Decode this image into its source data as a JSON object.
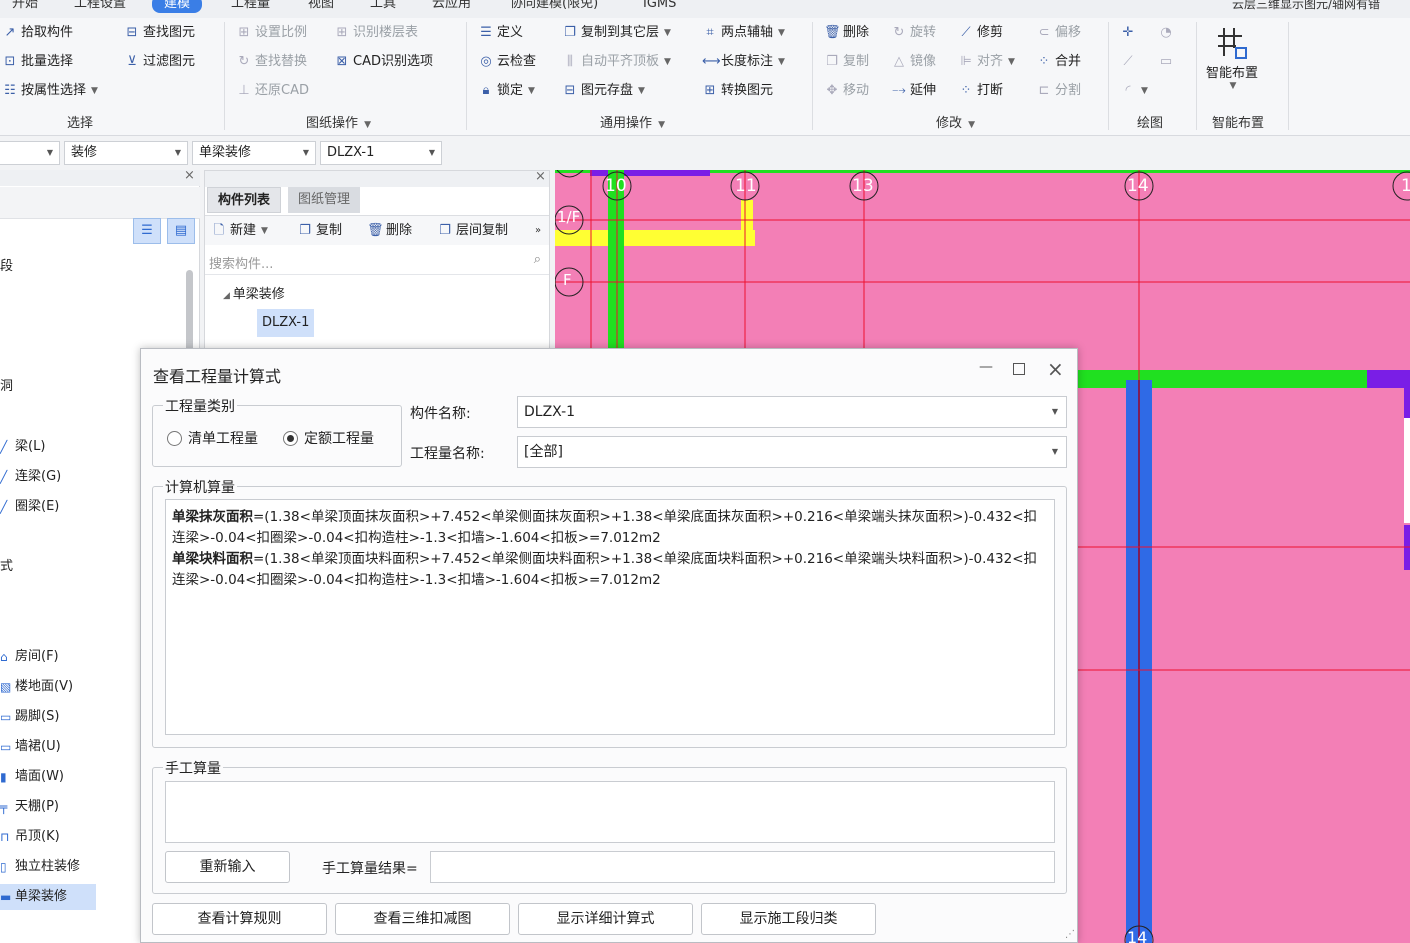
{
  "menu": [
    "开始",
    "工程设置",
    "建模",
    "工程量",
    "视图",
    "工具",
    "云应用",
    "协同建模(限免)",
    "IGMS"
  ],
  "menu_active": "建模",
  "title_right": "云层三维显示图元/轴网有错",
  "ribbon": {
    "select": {
      "label": "选择",
      "items": [
        "拾取构件",
        "批量选择",
        "按属性选择",
        "查找图元",
        "过滤图元"
      ]
    },
    "drawing_ops": {
      "label": "图纸操作",
      "items": [
        "设置比例",
        "识别楼层表",
        "查找替换",
        "CAD识别选项",
        "还原CAD"
      ]
    },
    "general_ops": {
      "label": "通用操作",
      "items": [
        "定义",
        "复制到其它层",
        "两点辅轴",
        "云检查",
        "自动平齐顶板",
        "长度标注",
        "锁定",
        "图元存盘",
        "转换图元"
      ]
    },
    "modify": {
      "label": "修改",
      "items": [
        "删除",
        "旋转",
        "修剪",
        "偏移",
        "复制",
        "镜像",
        "对齐",
        "合并",
        "移动",
        "延伸",
        "打断",
        "分割"
      ]
    },
    "draw": {
      "label": "绘图"
    },
    "smart": {
      "label": "智能布置",
      "button": "智能布置"
    }
  },
  "selectors": [
    "",
    "装修",
    "单梁装修",
    "DLZX-1"
  ],
  "left_nav": {
    "partial": [
      "段",
      "洞",
      "式"
    ],
    "items": [
      "梁(L)",
      "连梁(G)",
      "圈梁(E)",
      "房间(F)",
      "楼地面(V)",
      "踢脚(S)",
      "墙裙(U)",
      "墙面(W)",
      "天棚(P)",
      "吊顶(K)",
      "独立柱装修",
      "单梁装修"
    ],
    "selected": "单梁装修"
  },
  "mid_panel": {
    "tabs": [
      "构件列表",
      "图纸管理"
    ],
    "toolbar": [
      "新建",
      "复制",
      "删除",
      "层间复制"
    ],
    "search_placeholder": "搜索构件...",
    "tree_parent": "单梁装修",
    "tree_child": "DLZX-1"
  },
  "canvas": {
    "axis_labels": [
      "10",
      "11",
      "13",
      "14",
      "1"
    ],
    "row_labels": [
      "1/F",
      "F"
    ],
    "bottom_label": "14"
  },
  "dialog": {
    "title": "查看工程量计算式",
    "qty_type": {
      "legend": "工程量类别",
      "options": [
        "清单工程量",
        "定额工程量"
      ],
      "selected": "定额工程量"
    },
    "component_label": "构件名称:",
    "component_value": "DLZX-1",
    "qty_name_label": "工程量名称:",
    "qty_name_value": "[全部]",
    "computer_legend": "计算机算量",
    "formula1_name": "单梁抹灰面积",
    "formula1_body": "=(1.38<单梁顶面抹灰面积>+7.452<单梁侧面抹灰面积>+1.38<单梁底面抹灰面积>+0.216<单梁端头抹灰面积>)-0.432<扣连梁>-0.04<扣圈梁>-0.04<扣构造柱>-1.3<扣墙>-1.604<扣板>=7.012m2",
    "formula2_name": "单梁块料面积",
    "formula2_body": "=(1.38<单梁顶面块料面积>+7.452<单梁侧面块料面积>+1.38<单梁底面块料面积>+0.216<单梁端头块料面积>)-0.432<扣连梁>-0.04<扣圈梁>-0.04<扣构造柱>-1.3<扣墙>-1.604<扣板>=7.012m2",
    "manual_legend": "手工算量",
    "reinput_button": "重新输入",
    "manual_result_label": "手工算量结果=",
    "footer_buttons": [
      "查看计算规则",
      "查看三维扣减图",
      "显示详细计算式",
      "显示施工段归类"
    ]
  }
}
